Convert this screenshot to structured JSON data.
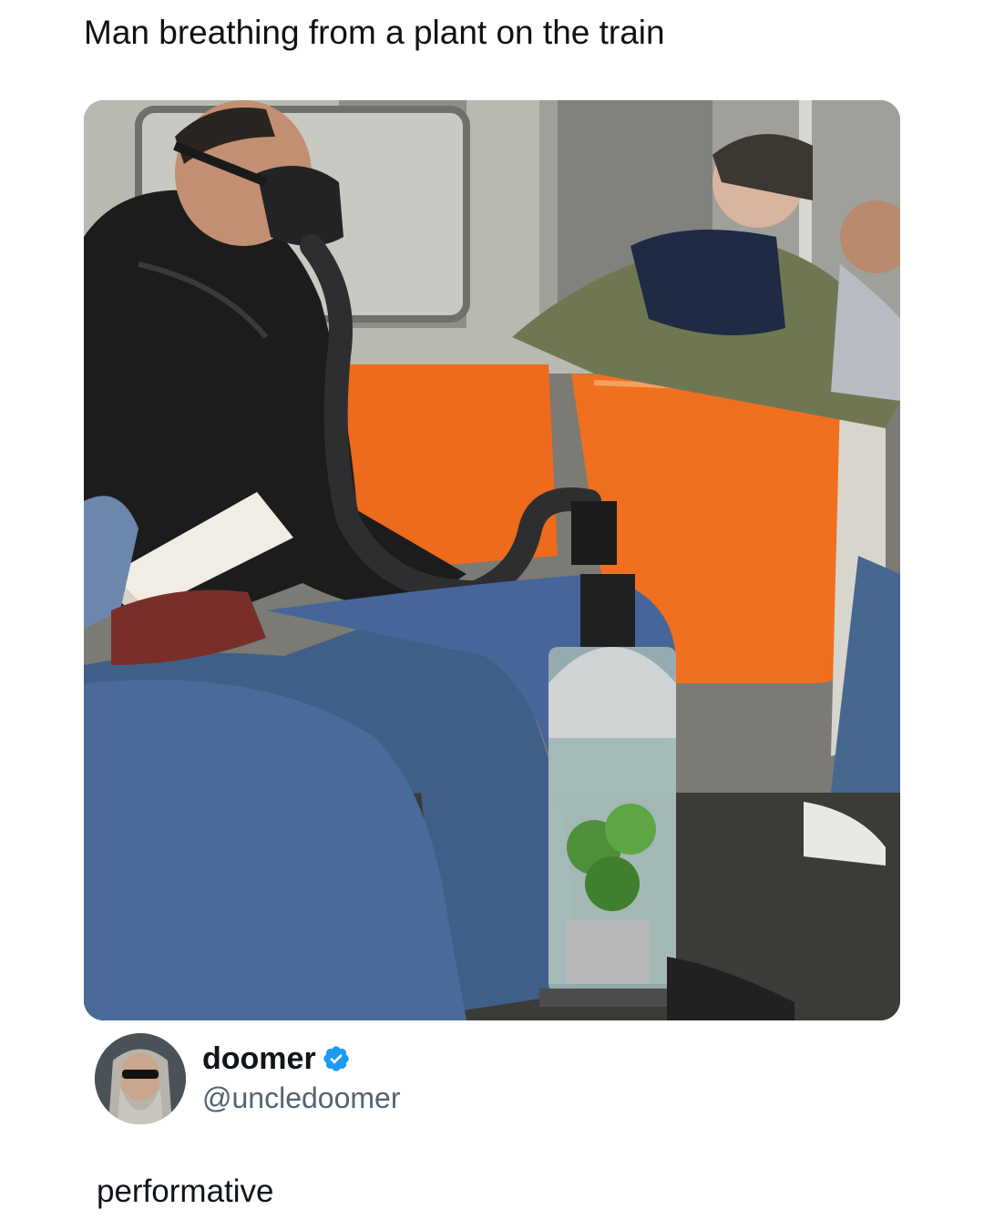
{
  "post": {
    "caption": "Man breathing from a plant on the train",
    "author": {
      "display_name": "doomer",
      "handle": "@uncledoomer",
      "verified": true,
      "verified_color": "#1d9bf0"
    },
    "text": "performative"
  },
  "icons": {
    "verified": "verified-badge-icon",
    "avatar": "avatar-image"
  }
}
